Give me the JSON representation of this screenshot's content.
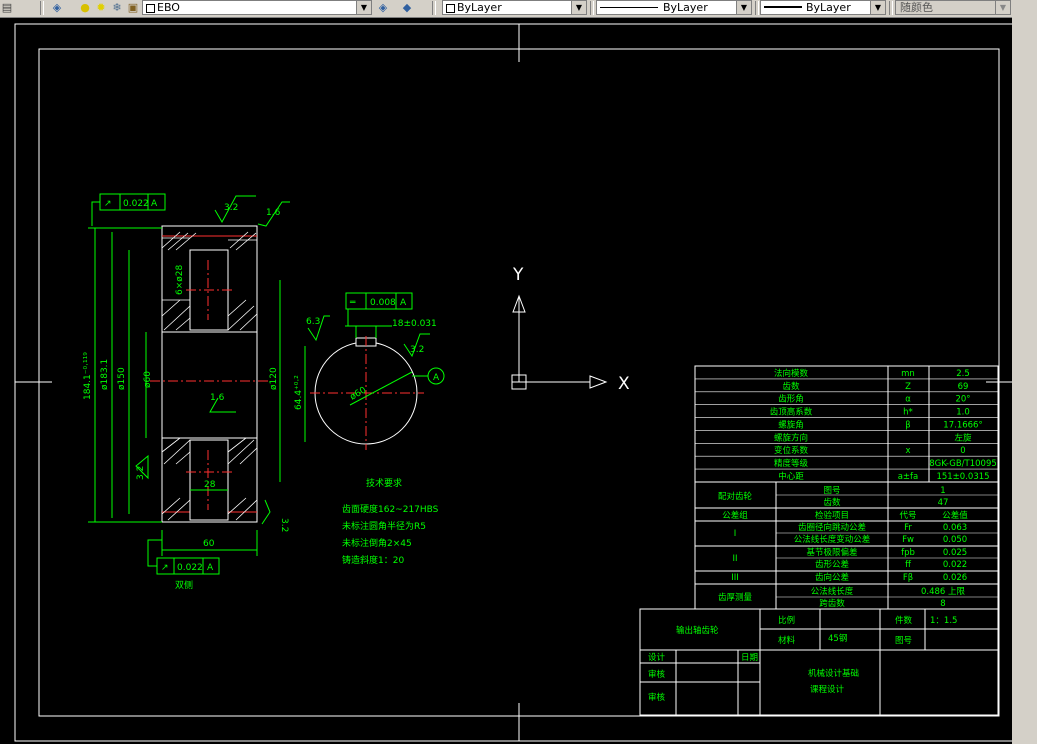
{
  "toolbar": {
    "layer_name": "EBO",
    "color_combo": "ByLayer",
    "linetype_combo": "ByLayer",
    "lineweight_combo": "ByLayer",
    "plotstyle_combo": "随颜色"
  },
  "icons": [
    "layers-icon",
    "lightbulb-icon",
    "sun-icon",
    "lock-icon",
    "layer-previous-icon",
    "layer-states-icon"
  ],
  "ucs": {
    "y_label": "Y",
    "x_label": "X"
  },
  "drawing": {
    "dims": {
      "tol_top": "0.022",
      "datum_top": "A",
      "rough_top1": "3.2",
      "rough_top2": "1.6",
      "od": "184.1⁻⁰·¹¹⁹",
      "d2": "ø183.1",
      "d3": "ø150",
      "d4": "ø60",
      "d5": "ø120",
      "hole": "6×ø28",
      "rough_web": "1.6",
      "web_w": "28",
      "rough_left": "3.2",
      "rough_right": "3.2",
      "width": "60",
      "tol_bot": "0.022",
      "datum_bot": "A",
      "bot_caption": "双侧",
      "key_flat": "0.008",
      "key_flat_datum": "A",
      "key_rough1": "6.3",
      "key_width": "18±0.031",
      "key_rough2": "3.2",
      "key_depth": "64.4⁺⁰·²",
      "bore": "ø60",
      "datum_circle": "A"
    },
    "tech_title": "技术要求",
    "tech_lines": [
      "齿面硬度162~217HBS",
      "未标注圆角半径为R5",
      "未标注倒角2×45",
      "铸造斜度1：20"
    ]
  },
  "param_table": {
    "rows": [
      {
        "name": "法向模数",
        "sym": "mn",
        "val": "2.5"
      },
      {
        "name": "齿数",
        "sym": "Z",
        "val": "69"
      },
      {
        "name": "齿形角",
        "sym": "α",
        "val": "20°"
      },
      {
        "name": "齿顶高系数",
        "sym": "h*",
        "val": "1.0"
      },
      {
        "name": "螺旋角",
        "sym": "β",
        "val": "17.1666°"
      },
      {
        "name": "螺旋方向",
        "sym": "",
        "val": "左旋"
      },
      {
        "name": "变位系数",
        "sym": "x",
        "val": "0"
      },
      {
        "name": "精度等级",
        "sym": "",
        "val": "8GK-GB/T10095"
      },
      {
        "name": "中心距",
        "sym": "a±fa",
        "val": "151±0.0315"
      }
    ],
    "mate_label": "配对齿轮",
    "mate_rows": [
      {
        "k": "图号",
        "v": "1"
      },
      {
        "k": "齿数",
        "v": "47"
      }
    ],
    "group_label": "公差组",
    "check_item": "检验项目",
    "code": "代号",
    "tol_value": "公差值",
    "tol_rows": [
      {
        "g": "I",
        "name": "齿圈径向跳动公差",
        "sym": "Fr",
        "val": "0.063"
      },
      {
        "g": "",
        "name": "公法线长度变动公差",
        "sym": "Fw",
        "val": "0.050"
      },
      {
        "g": "II",
        "name": "基节极限偏差",
        "sym": "fpb",
        "val": "0.025"
      },
      {
        "g": "",
        "name": "齿形公差",
        "sym": "ff",
        "val": "0.022"
      },
      {
        "g": "III",
        "name": "齿向公差",
        "sym": "Fβ",
        "val": "0.026"
      }
    ],
    "thick_label": "齿厚测量",
    "thick_rows": [
      {
        "name": "公法线长度",
        "val": "0.486 上限"
      },
      {
        "name": "跨齿数",
        "val": "8"
      }
    ]
  },
  "title_block": {
    "part_name": "输出轴齿轮",
    "scale_label": "比例",
    "scale_val": "1：1.5",
    "material_label": "材料",
    "material_val": "45钢",
    "qty_label": "件数",
    "drawing_label": "图号",
    "designer_label": "设计",
    "checker_label": "审核",
    "date_label": "日期",
    "school_line1": "机械设计基础",
    "school_line2": "课程设计"
  }
}
